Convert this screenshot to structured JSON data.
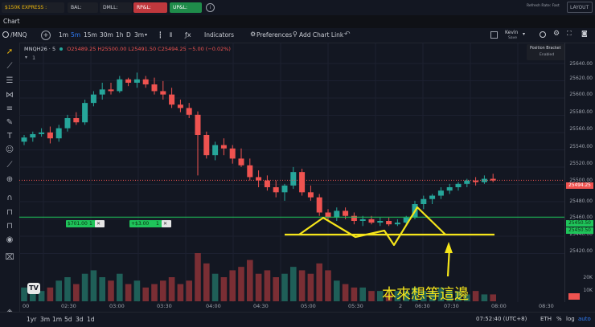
{
  "topbar": {
    "account_selector": "$150K EXPRESS : ******",
    "bal_label": "BAL: ******",
    "dmll_label": "DMLL: ******",
    "rpl_label": "RP&L: $-2.96",
    "upl_label": "UP&L: $701.00",
    "refresh_label": "Refresh Rate: Fast",
    "layout_label": "LAYOUT L",
    "colors": {
      "rpl_bg": "#c0383d",
      "upl_bg": "#1f8c4a",
      "acct_text": "#f0b90b"
    }
  },
  "chart_tab": {
    "label": "Chart"
  },
  "toolbar": {
    "symbol": "/MNQ",
    "intervals": [
      "1m",
      "5m",
      "15m",
      "30m",
      "1h",
      "D",
      "3m"
    ],
    "active_interval": "5m",
    "indicators_label": "Indicators",
    "preferences_label": "Preferences",
    "chart_link_label": "Add Chart Link",
    "user_name": "Kevin",
    "user_status": "Save"
  },
  "position_bracket": {
    "title": "Position Bracket",
    "status": "Enabled"
  },
  "legend": {
    "symbol": "MNQH26 · 5",
    "open": "O25489.25",
    "high": "H25500.00",
    "low": "L25491.50",
    "close": "C25494.25",
    "change": "−5.00 (−0.02%)",
    "count": "1"
  },
  "price_axis": {
    "labels": [
      "25640.00",
      "25620.00",
      "25600.00",
      "25580.00",
      "25560.00",
      "25540.00",
      "25520.00",
      "25500.00",
      "25480.00",
      "25460.00",
      "25440.00",
      "25420.00",
      "20K",
      "10K"
    ],
    "current_price": "25494.25",
    "line_price_a": "25450.50",
    "line_price_b": "25450.50"
  },
  "time_axis": {
    "labels": [
      "00",
      "02:30",
      "03:00",
      "03:30",
      "04:00",
      "04:30",
      "05:00",
      "05:30",
      "2",
      "06:30",
      "07:30",
      "08:00",
      "08:30"
    ]
  },
  "orders": {
    "order_a_label": "$701.00",
    "order_a_qty": "1",
    "order_b_label": "+$3.00",
    "order_b_qty": "1",
    "close_glyph": "✕"
  },
  "annotation": {
    "text": "本來想等這邊"
  },
  "bottombar": {
    "ranges": [
      "1yr",
      "3m",
      "1m",
      "5d",
      "3d",
      "1d"
    ],
    "time": "07:52:40 (UTC+8)",
    "session": "ETH",
    "pct": "%",
    "log": "log",
    "auto": "auto"
  },
  "candle_colors": {
    "up": "#26a69a",
    "down": "#ef5350",
    "vol_up": "#1f5f58",
    "vol_down": "#7a2e34"
  },
  "chart_data": {
    "type": "candlestick",
    "x_range": [
      "02:00",
      "08:45"
    ],
    "y_range": [
      25405,
      25650
    ],
    "ohlc": [
      [
        25540,
        25548,
        25536,
        25545
      ],
      [
        25545,
        25552,
        25540,
        25549
      ],
      [
        25549,
        25556,
        25546,
        25551
      ],
      [
        25551,
        25558,
        25538,
        25544
      ],
      [
        25544,
        25560,
        25540,
        25556
      ],
      [
        25556,
        25572,
        25552,
        25568
      ],
      [
        25568,
        25575,
        25560,
        25563
      ],
      [
        25563,
        25590,
        25560,
        25586
      ],
      [
        25586,
        25600,
        25582,
        25596
      ],
      [
        25596,
        25610,
        25590,
        25602
      ],
      [
        25602,
        25610,
        25596,
        25600
      ],
      [
        25600,
        25618,
        25598,
        25614
      ],
      [
        25614,
        25616,
        25606,
        25610
      ],
      [
        25610,
        25622,
        25604,
        25614
      ],
      [
        25614,
        25618,
        25604,
        25608
      ],
      [
        25608,
        25616,
        25596,
        25600
      ],
      [
        25600,
        25612,
        25590,
        25596
      ],
      [
        25596,
        25604,
        25580,
        25584
      ],
      [
        25584,
        25590,
        25575,
        25580
      ],
      [
        25580,
        25586,
        25568,
        25572
      ],
      [
        25572,
        25576,
        25500,
        25548
      ],
      [
        25548,
        25552,
        25520,
        25524
      ],
      [
        25524,
        25540,
        25518,
        25536
      ],
      [
        25536,
        25544,
        25524,
        25532
      ],
      [
        25532,
        25536,
        25514,
        25520
      ],
      [
        25520,
        25532,
        25510,
        25512
      ],
      [
        25512,
        25520,
        25494,
        25498
      ],
      [
        25498,
        25506,
        25486,
        25494
      ],
      [
        25494,
        25500,
        25482,
        25486
      ],
      [
        25486,
        25494,
        25474,
        25480
      ],
      [
        25480,
        25490,
        25470,
        25488
      ],
      [
        25488,
        25510,
        25484,
        25504
      ],
      [
        25504,
        25508,
        25476,
        25480
      ],
      [
        25480,
        25488,
        25470,
        25474
      ],
      [
        25474,
        25478,
        25452,
        25456
      ],
      [
        25456,
        25460,
        25446,
        25450
      ],
      [
        25450,
        25462,
        25446,
        25458
      ],
      [
        25458,
        25462,
        25448,
        25452
      ],
      [
        25452,
        25456,
        25442,
        25446
      ],
      [
        25446,
        25452,
        25440,
        25448
      ],
      [
        25448,
        25452,
        25442,
        25444
      ],
      [
        25444,
        25450,
        25440,
        25446
      ],
      [
        25446,
        25450,
        25440,
        25442
      ],
      [
        25442,
        25448,
        25440,
        25444
      ],
      [
        25444,
        25452,
        25442,
        25450
      ],
      [
        25450,
        25470,
        25448,
        25466
      ],
      [
        25466,
        25476,
        25460,
        25472
      ],
      [
        25472,
        25478,
        25466,
        25476
      ],
      [
        25476,
        25486,
        25472,
        25482
      ],
      [
        25482,
        25490,
        25478,
        25486
      ],
      [
        25486,
        25492,
        25482,
        25490
      ],
      [
        25490,
        25496,
        25486,
        25494
      ],
      [
        25494,
        25498,
        25488,
        25492
      ],
      [
        25492,
        25500,
        25490,
        25496
      ],
      [
        25496,
        25502,
        25492,
        25494
      ]
    ],
    "volume": [
      4,
      5,
      3,
      4,
      6,
      7,
      5,
      8,
      9,
      7,
      6,
      8,
      5,
      6,
      4,
      5,
      6,
      7,
      5,
      6,
      14,
      11,
      8,
      7,
      9,
      10,
      12,
      8,
      9,
      7,
      8,
      10,
      9,
      8,
      11,
      9,
      6,
      5,
      4,
      4,
      3,
      3,
      2,
      3,
      3,
      4,
      3,
      3,
      4,
      3,
      3,
      2,
      3,
      2,
      2
    ]
  }
}
